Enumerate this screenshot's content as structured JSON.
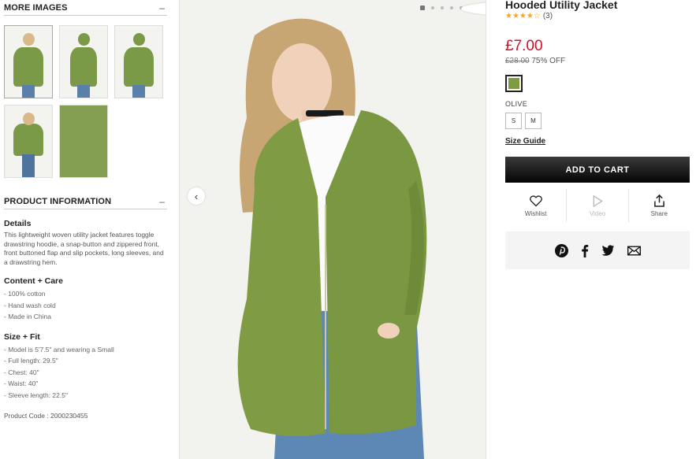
{
  "more_images": {
    "title": "MORE IMAGES",
    "toggle": "–"
  },
  "product_info": {
    "title": "PRODUCT INFORMATION",
    "toggle": "–",
    "details_heading": "Details",
    "details_text": "This lightweight woven utility jacket features toggle drawstring hoodie, a snap-button and zippered front, front buttoned flap and slip pockets, long sleeves, and a drawstring hem.",
    "content_heading": "Content + Care",
    "content_items": [
      "- 100% cotton",
      "- Hand wash cold",
      "- Made in China"
    ],
    "size_heading": "Size + Fit",
    "size_items": [
      "- Model is 5'7.5\" and wearing a Small",
      "- Full length: 29.5\"",
      "- Chest: 40\"",
      "- Waist: 40\"",
      "- Sleeve length: 22.5\""
    ],
    "product_code": "Product Code : 2000230455"
  },
  "gallery": {
    "prev_icon": "‹",
    "next_icon": "›"
  },
  "product": {
    "title": "Hooded Utility Jacket",
    "rating": 4,
    "stars": "★★★★☆",
    "review_count": "(3)",
    "price": "£7.00",
    "original_price": "£28.00",
    "discount": "75% OFF",
    "color_name": "OLIVE",
    "color_hex": "#7f9c45",
    "sizes": [
      "S",
      "M"
    ],
    "size_guide": "Size Guide",
    "add_to_cart": "ADD TO CART"
  },
  "actions": {
    "wishlist": "Wishlist",
    "video": "Video",
    "share": "Share"
  },
  "colors": {
    "accent_price": "#d0102a",
    "star": "#f5a623"
  }
}
